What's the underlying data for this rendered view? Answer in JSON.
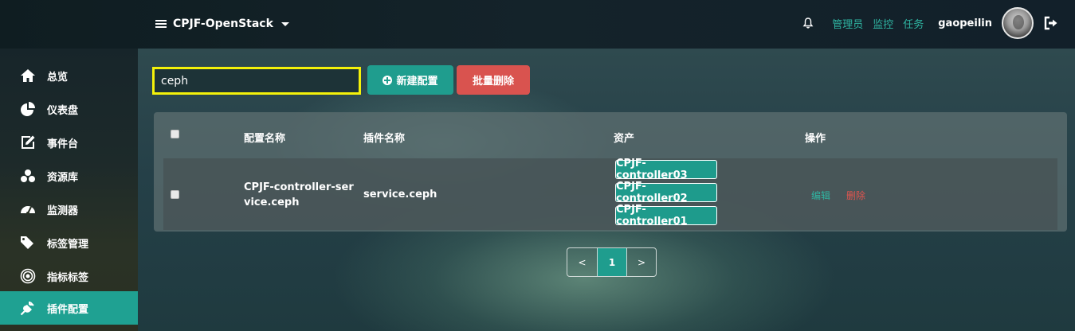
{
  "header": {
    "project": "CPJF-OpenStack",
    "links": [
      "管理员",
      "监控",
      "任务"
    ],
    "username": "gaopeilin"
  },
  "sidebar": {
    "items": [
      {
        "label": "总览",
        "icon": "home-icon"
      },
      {
        "label": "仪表盘",
        "icon": "pie-chart-icon"
      },
      {
        "label": "事件台",
        "icon": "edit-icon"
      },
      {
        "label": "资源库",
        "icon": "cubes-icon"
      },
      {
        "label": "监测器",
        "icon": "dashboard-gauge-icon"
      },
      {
        "label": "标签管理",
        "icon": "tags-icon"
      },
      {
        "label": "指标标签",
        "icon": "target-icon"
      },
      {
        "label": "插件配置",
        "icon": "plug-icon",
        "active": true
      }
    ]
  },
  "toolbar": {
    "search_value": "ceph",
    "new_label": "新建配置",
    "batch_delete_label": "批量删除"
  },
  "table": {
    "columns": [
      "配置名称",
      "插件名称",
      "资产",
      "操作"
    ],
    "rows": [
      {
        "config_name_line1": "CPJF-controller-ser",
        "config_name_line2": "vice.ceph",
        "plugin_name": "service.ceph",
        "assets": [
          "CPJF-controller03",
          "CPJF-controller02",
          "CPJF-controller01"
        ],
        "actions": {
          "edit": "编辑",
          "delete": "删除"
        }
      }
    ]
  },
  "pagination": {
    "prev": "<",
    "current": "1",
    "next": ">"
  },
  "colors": {
    "accent": "#1f9d8e",
    "danger": "#d9534f",
    "link": "#2fb5a2",
    "search_border": "#f4f10a"
  }
}
